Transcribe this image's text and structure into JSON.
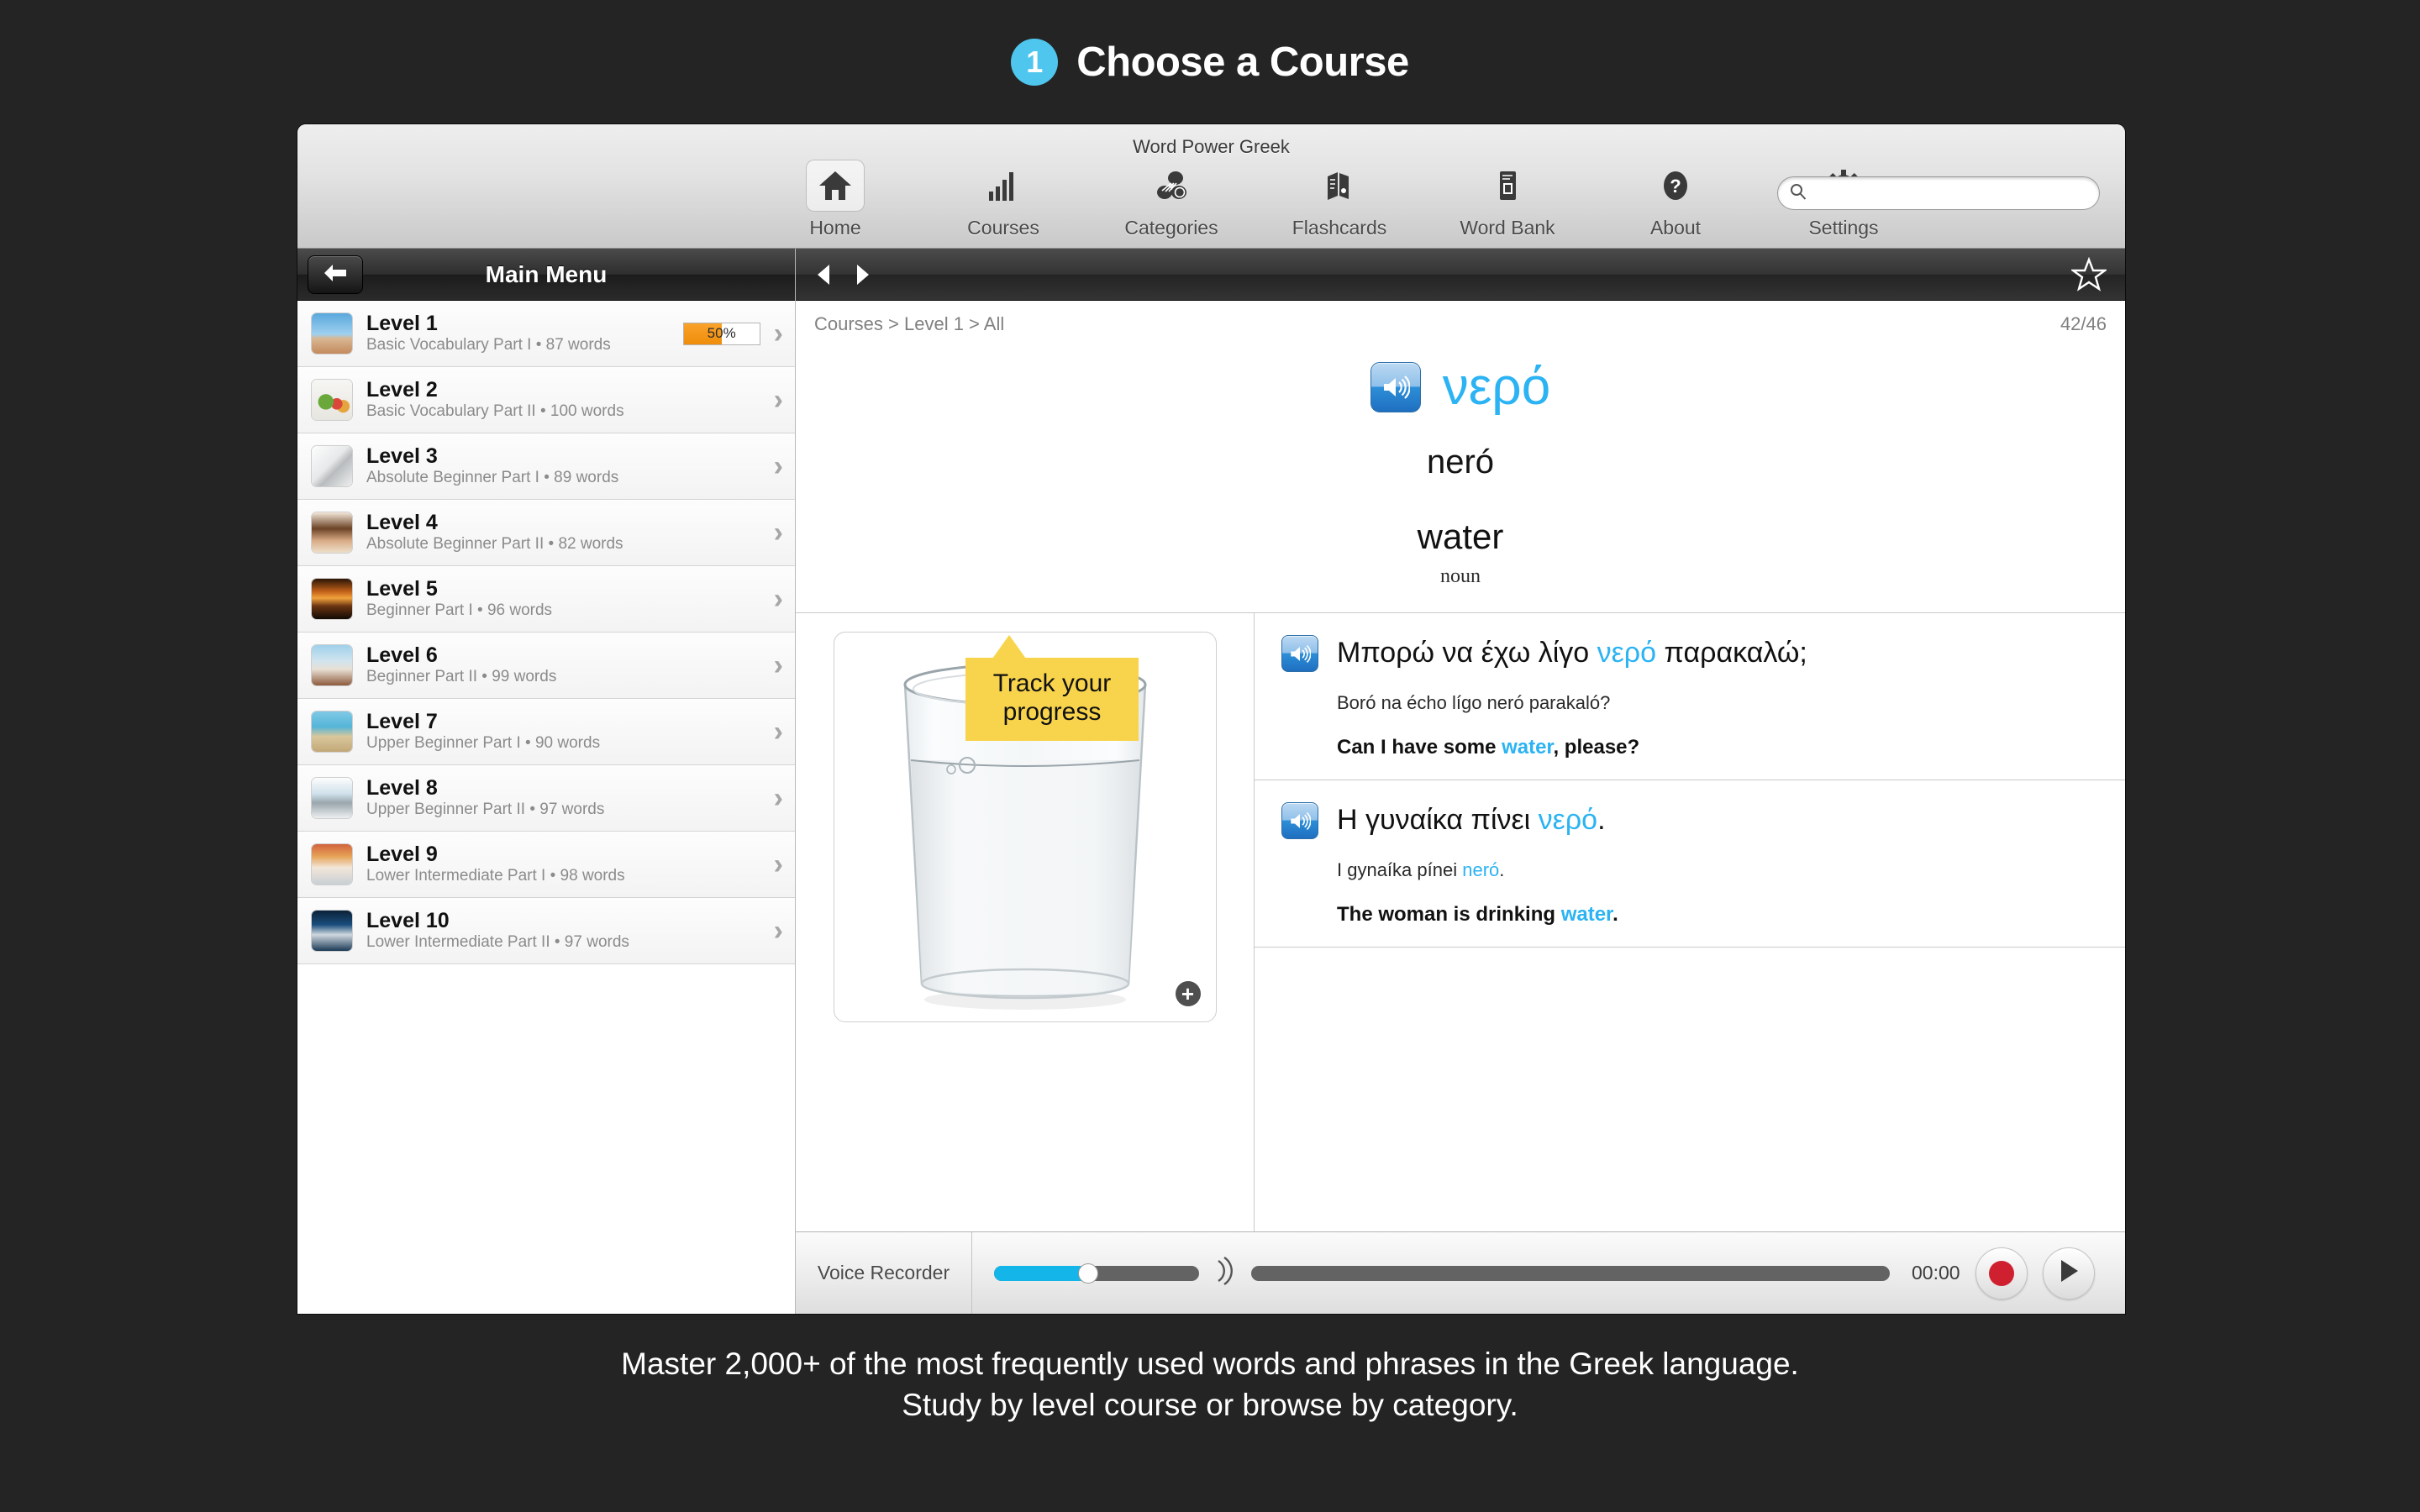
{
  "header": {
    "step_number": "1",
    "title": "Choose a Course",
    "badge_color": "#4FC6ED"
  },
  "window": {
    "title": "Word Power Greek"
  },
  "toolbar": {
    "items": [
      {
        "label": "Home",
        "icon": "home-icon",
        "active": true
      },
      {
        "label": "Courses",
        "icon": "bar-chart-icon",
        "active": false
      },
      {
        "label": "Categories",
        "icon": "categories-icon",
        "active": false
      },
      {
        "label": "Flashcards",
        "icon": "flashcards-icon",
        "active": false
      },
      {
        "label": "Word Bank",
        "icon": "word-bank-icon",
        "active": false
      },
      {
        "label": "About",
        "icon": "question-mark-icon",
        "active": false
      },
      {
        "label": "Settings",
        "icon": "gear-icon",
        "active": false
      }
    ],
    "search": {
      "value": "",
      "placeholder": ""
    }
  },
  "sidebar": {
    "title": "Main Menu",
    "back_label": "Back",
    "levels": [
      {
        "name": "Level 1",
        "sub": "Basic Vocabulary Part I • 87 words",
        "progress": "50%",
        "progress_value": 50,
        "thumb": "hurdle-runner"
      },
      {
        "name": "Level 2",
        "sub": "Basic Vocabulary Part II • 100 words",
        "progress": null,
        "progress_value": 0,
        "thumb": "vegetables"
      },
      {
        "name": "Level 3",
        "sub": "Absolute Beginner Part I • 89 words",
        "progress": null,
        "progress_value": 0,
        "thumb": "keys"
      },
      {
        "name": "Level 4",
        "sub": "Absolute Beginner Part II • 82 words",
        "progress": null,
        "progress_value": 0,
        "thumb": "girl-brushing-teeth"
      },
      {
        "name": "Level 5",
        "sub": "Beginner Part I • 96 words",
        "progress": null,
        "progress_value": 0,
        "thumb": "sunset"
      },
      {
        "name": "Level 6",
        "sub": "Beginner Part II • 99 words",
        "progress": null,
        "progress_value": 0,
        "thumb": "bed-blanket"
      },
      {
        "name": "Level 7",
        "sub": "Upper Beginner Part I • 90 words",
        "progress": null,
        "progress_value": 0,
        "thumb": "beach-woman"
      },
      {
        "name": "Level 8",
        "sub": "Upper Beginner Part II • 97 words",
        "progress": null,
        "progress_value": 0,
        "thumb": "laptop"
      },
      {
        "name": "Level 9",
        "sub": "Lower Intermediate Part I • 98 words",
        "progress": null,
        "progress_value": 0,
        "thumb": "man-market"
      },
      {
        "name": "Level 10",
        "sub": "Lower Intermediate Part II • 97 words",
        "progress": null,
        "progress_value": 0,
        "thumb": "tennis-player"
      }
    ]
  },
  "callout": {
    "text": "Track your progress",
    "color": "#F8D44C"
  },
  "content": {
    "breadcrumb": "Courses > Level 1 > All",
    "counter": "42/46",
    "word": {
      "target": "νερό",
      "romanization": "neró",
      "translation": "water",
      "part_of_speech": "noun",
      "accent_color": "#2BB3F3"
    },
    "image": {
      "alt": "glass-of-water",
      "zoom_badge": "+"
    },
    "sentences": [
      {
        "greek_pre": "Μπορώ να έχω λίγο ",
        "greek_hl": "νερό",
        "greek_post": " παρακαλώ;",
        "roman_pre": "Boró na écho lígo neró parakaló?",
        "roman_hl": "",
        "roman_post": "",
        "eng_pre": "Can I have some ",
        "eng_hl": "water",
        "eng_post": ", please?"
      },
      {
        "greek_pre": "Η γυναίκα πίνει ",
        "greek_hl": "νερό",
        "greek_post": ".",
        "roman_pre": "I gynaíka pínei ",
        "roman_hl": "neró",
        "roman_post": ".",
        "eng_pre": "The woman is drinking ",
        "eng_hl": "water",
        "eng_post": "."
      }
    ]
  },
  "recorder": {
    "label": "Voice Recorder",
    "time": "00:00",
    "volume_percent": 46,
    "record_label": "Record",
    "play_label": "Play"
  },
  "footer": {
    "line1": "Master 2,000+ of the most frequently used words and phrases in the Greek language.",
    "line2": "Study by level course or browse by category."
  }
}
